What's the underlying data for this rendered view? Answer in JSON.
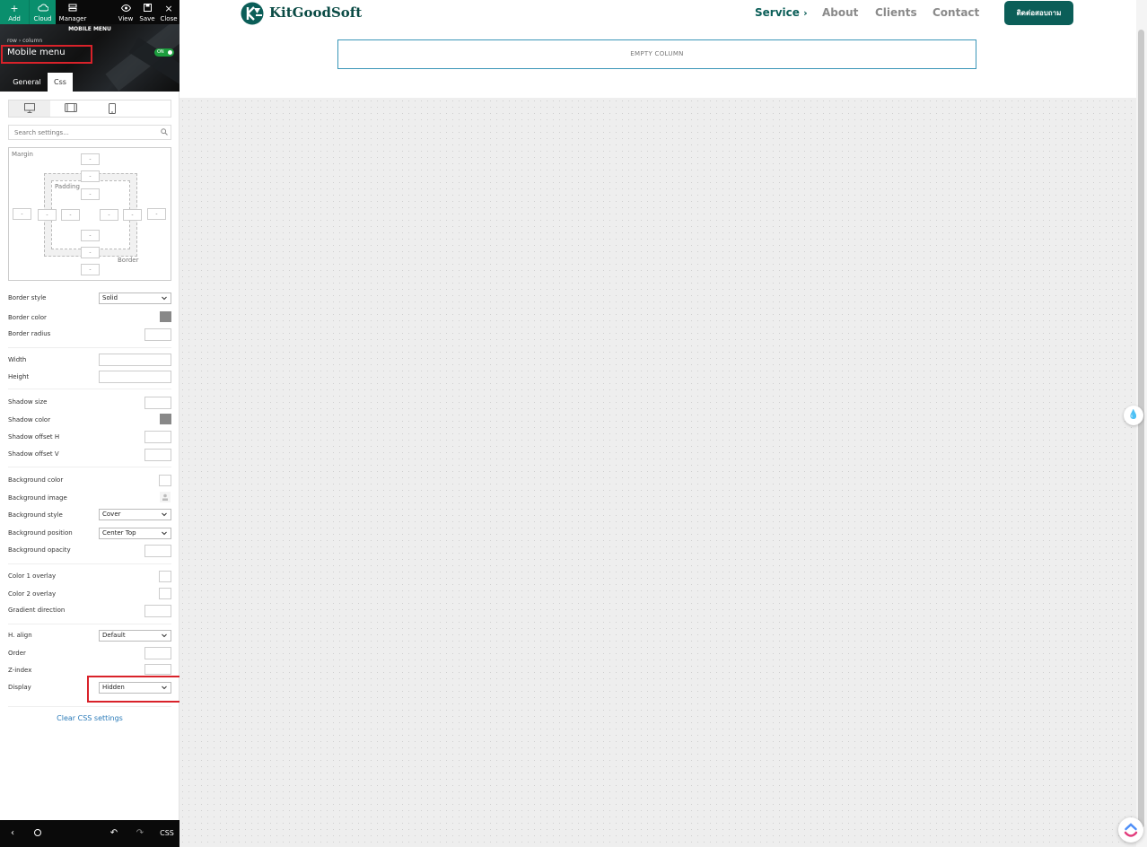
{
  "toolbar": {
    "add": "Add",
    "cloud": "Cloud",
    "manager": "Manager",
    "view": "View",
    "save": "Save",
    "close": "Close"
  },
  "panel": {
    "title": "MOBILE MENU",
    "breadcrumb": "row › column",
    "element_name": "Mobile menu",
    "toggle": "ON",
    "tabs": [
      "General",
      "Css"
    ],
    "search_placeholder": "Search settings...",
    "boxmodel": {
      "margin_label": "Margin",
      "padding_label": "Padding",
      "border_label": "Border",
      "empty_value": "-"
    },
    "settings": {
      "border_style": {
        "label": "Border style",
        "value": "Solid"
      },
      "border_color": {
        "label": "Border color"
      },
      "border_radius": {
        "label": "Border radius"
      },
      "width": {
        "label": "Width"
      },
      "height": {
        "label": "Height"
      },
      "shadow_size": {
        "label": "Shadow size"
      },
      "shadow_color": {
        "label": "Shadow color"
      },
      "shadow_offset_h": {
        "label": "Shadow offset H"
      },
      "shadow_offset_v": {
        "label": "Shadow offset V"
      },
      "background_color": {
        "label": "Background color"
      },
      "background_image": {
        "label": "Background image"
      },
      "background_style": {
        "label": "Background style",
        "value": "Cover"
      },
      "background_position": {
        "label": "Background position",
        "value": "Center Top"
      },
      "background_opacity": {
        "label": "Background opacity"
      },
      "color1_overlay": {
        "label": "Color 1 overlay"
      },
      "color2_overlay": {
        "label": "Color 2 overlay"
      },
      "gradient_direction": {
        "label": "Gradient direction"
      },
      "h_align": {
        "label": "H. align",
        "value": "Default"
      },
      "order": {
        "label": "Order"
      },
      "z_index": {
        "label": "Z-index"
      },
      "display": {
        "label": "Display",
        "value": "Hidden"
      }
    },
    "clear_css": "Clear CSS settings"
  },
  "bottombar": {
    "css": "CSS"
  },
  "site": {
    "logo": "KitGoodSoft",
    "nav": {
      "service": "Service",
      "service_chevron": "›",
      "about": "About",
      "clients": "Clients",
      "contact": "Contact"
    },
    "cta": "ติดต่อสอบถาม",
    "empty_column": "EMPTY COLUMN"
  },
  "colors": {
    "accent_green": "#0a8f6d",
    "brand_teal": "#0b5e58",
    "highlight_red": "#d9222a",
    "toggle_green": "#1d9e3e"
  }
}
